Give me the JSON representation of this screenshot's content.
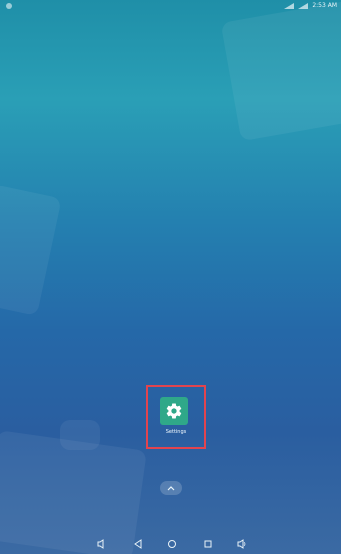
{
  "status_bar": {
    "time": "2:53 AM",
    "left_icon": "notification-icon",
    "right_icons": [
      "signal-icon",
      "wifi-icon"
    ]
  },
  "home": {
    "apps": [
      {
        "label": "Settings",
        "icon": "gear-icon",
        "color": "#2fa889"
      }
    ],
    "highlight_color": "#e2444e",
    "drawer_handle_icon": "chevron-up-icon"
  },
  "nav_bar": {
    "buttons": [
      {
        "icon": "volume-down-icon"
      },
      {
        "icon": "back-icon"
      },
      {
        "icon": "home-icon"
      },
      {
        "icon": "recents-icon"
      },
      {
        "icon": "volume-up-icon"
      }
    ]
  }
}
